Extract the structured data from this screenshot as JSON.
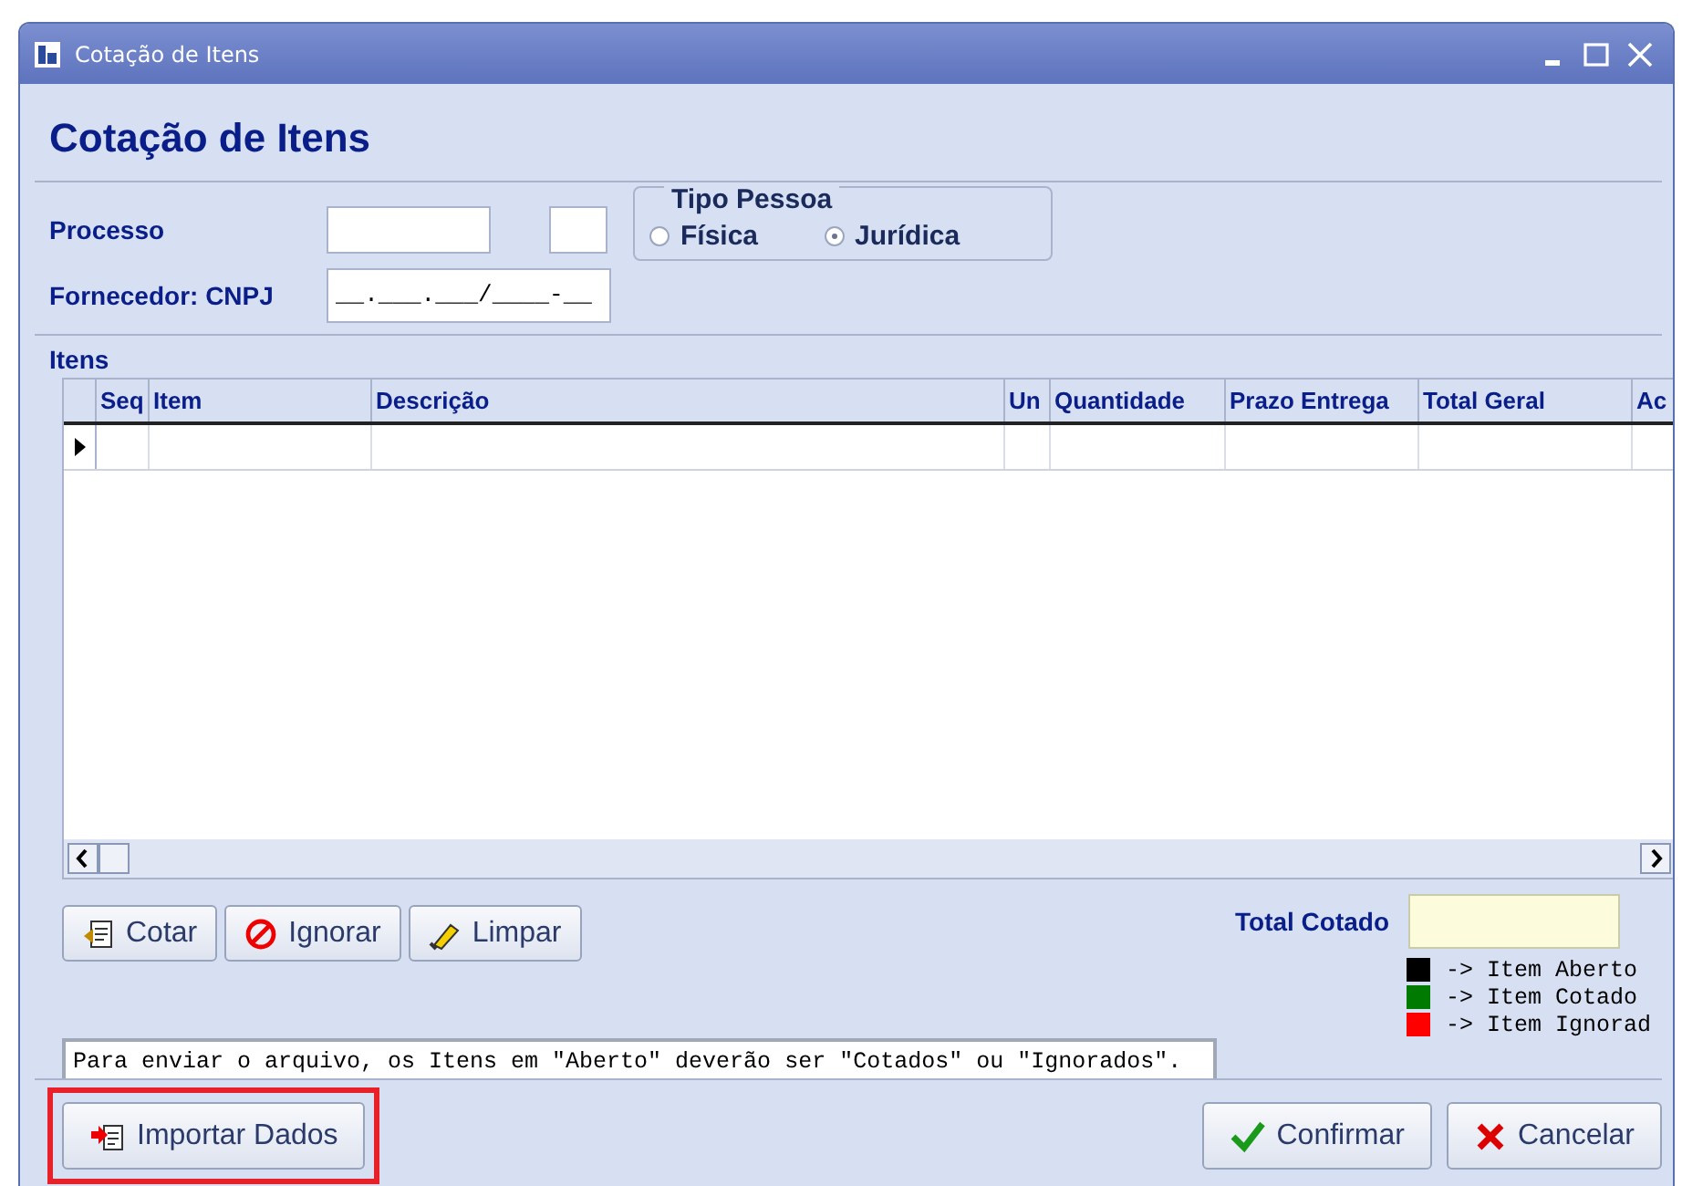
{
  "window": {
    "title": "Cotação de Itens"
  },
  "heading": "Cotação de Itens",
  "form": {
    "processo_label": "Processo",
    "tipo_pessoa": {
      "legend": "Tipo Pessoa",
      "options": [
        {
          "label": "Física",
          "selected": false
        },
        {
          "label": "Jurídica",
          "selected": true
        }
      ]
    },
    "cnpj_label": "Fornecedor: CNPJ",
    "cnpj_value": "__.___.___/____-__"
  },
  "items": {
    "label": "Itens",
    "columns": [
      "Seq",
      "Item",
      "Descrição",
      "Un",
      "Quantidade",
      "Prazo Entrega",
      "Total Geral",
      "Ac"
    ]
  },
  "actions": [
    "Cotar",
    "Ignorar",
    "Limpar"
  ],
  "total_label": "Total Cotado",
  "legend": [
    {
      "label": "-> Item Aberto",
      "color": "#000000"
    },
    {
      "label": "-> Item Cotado",
      "color": "#007a00"
    },
    {
      "label": "-> Item Ignorad",
      "color": "#ff0000"
    }
  ],
  "message": "Para enviar o arquivo, os Itens em \"Aberto\" deverão ser \"Cotados\" ou \"Ignorados\".",
  "footer": {
    "import": {
      "label": "Importar Dados",
      "highlighted": true
    },
    "confirm": "Confirmar",
    "cancel": "Cancelar"
  }
}
